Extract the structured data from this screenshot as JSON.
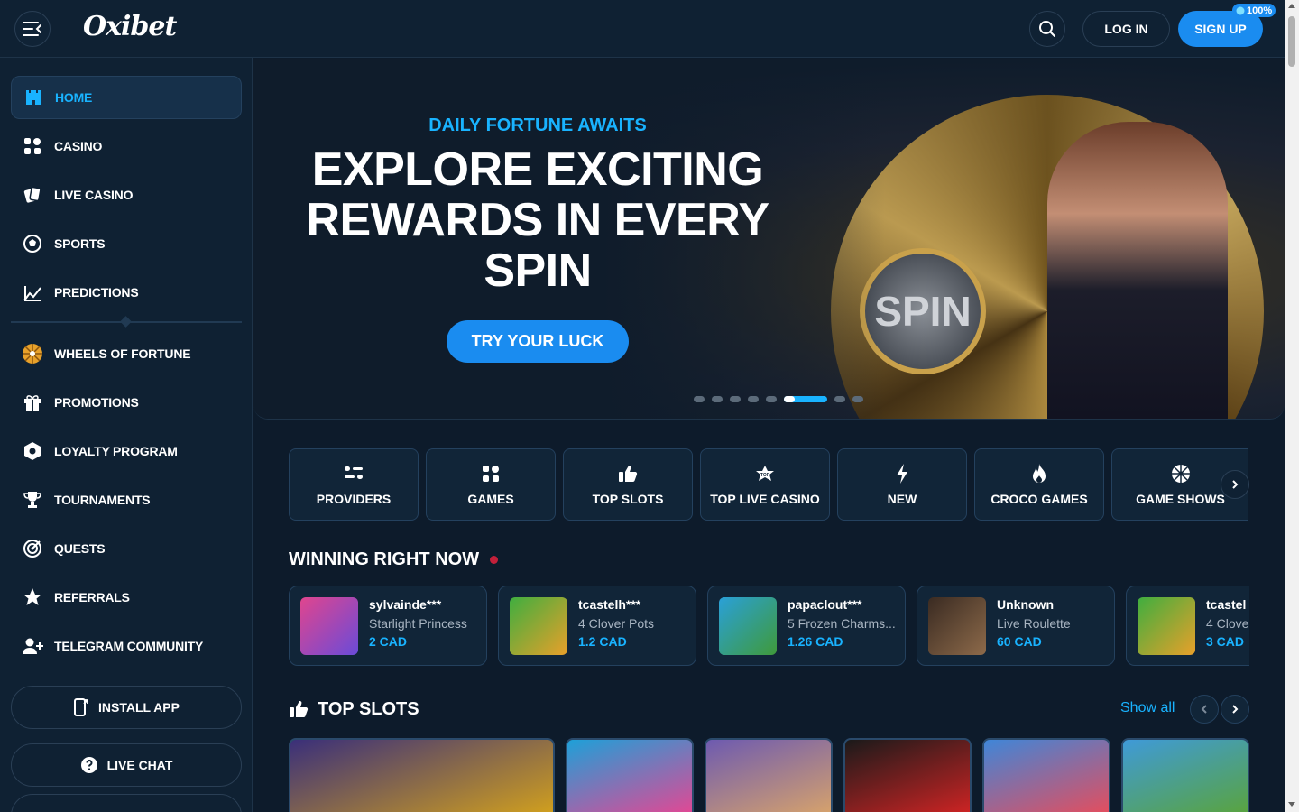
{
  "header": {
    "logo": "Oxibet",
    "login_label": "LOG IN",
    "signup_label": "SIGN UP",
    "signup_badge": "100%"
  },
  "sidebar": {
    "items": [
      {
        "label": "HOME",
        "icon": "castle-icon",
        "active": true
      },
      {
        "label": "CASINO",
        "icon": "grid-icon"
      },
      {
        "label": "LIVE CASINO",
        "icon": "cards-icon"
      },
      {
        "label": "SPORTS",
        "icon": "soccer-ball-icon"
      },
      {
        "label": "PREDICTIONS",
        "icon": "chart-icon"
      },
      {
        "label": "WHEELS OF FORTUNE",
        "icon": "wheel-icon"
      },
      {
        "label": "PROMOTIONS",
        "icon": "gift-icon"
      },
      {
        "label": "LOYALTY PROGRAM",
        "icon": "hexagon-icon"
      },
      {
        "label": "TOURNAMENTS",
        "icon": "trophy-icon"
      },
      {
        "label": "QUESTS",
        "icon": "target-icon"
      },
      {
        "label": "REFERRALS",
        "icon": "star-icon"
      },
      {
        "label": "TELEGRAM COMMUNITY",
        "icon": "add-user-icon"
      }
    ],
    "install_label": "INSTALL APP",
    "chat_label": "LIVE CHAT"
  },
  "hero": {
    "eyebrow": "DAILY FORTUNE AWAITS",
    "title": "EXPLORE EXCITING REWARDS IN EVERY SPIN",
    "cta": "TRY YOUR LUCK",
    "wheel_text": "SPIN",
    "slide_count": 8,
    "active_slide": 6
  },
  "categories": [
    {
      "label": "PROVIDERS",
      "icon": "providers-icon"
    },
    {
      "label": "GAMES",
      "icon": "grid-icon"
    },
    {
      "label": "TOP SLOTS",
      "icon": "thumbs-up-icon"
    },
    {
      "label": "TOP LIVE CASINO",
      "icon": "top-badge-icon"
    },
    {
      "label": "NEW",
      "icon": "lightning-icon"
    },
    {
      "label": "CROCO GAMES",
      "icon": "flame-icon"
    },
    {
      "label": "GAME SHOWS",
      "icon": "wheel-icon"
    }
  ],
  "winning": {
    "title": "WINNING RIGHT NOW",
    "items": [
      {
        "user": "sylvainde***",
        "game": "Starlight Princess",
        "amount": "2 CAD",
        "thumb": [
          "#e0458e",
          "#6a4bd8"
        ]
      },
      {
        "user": "tcastelh***",
        "game": "4 Clover Pots",
        "amount": "1.2 CAD",
        "thumb": [
          "#3fae3f",
          "#e8a02a"
        ]
      },
      {
        "user": "papaclout***",
        "game": "5 Frozen Charms...",
        "amount": "1.26 CAD",
        "thumb": [
          "#2aa0d8",
          "#3f9a3a"
        ]
      },
      {
        "user": "Unknown",
        "game": "Live Roulette",
        "amount": "60 CAD",
        "thumb": [
          "#3a2b22",
          "#8d6a4a"
        ]
      },
      {
        "user": "tcastel",
        "game": "4 Clove",
        "amount": "3 CAD",
        "thumb": [
          "#3fae3f",
          "#e8a02a"
        ]
      }
    ]
  },
  "top_slots": {
    "title": "TOP SLOTS",
    "show_all": "Show all",
    "thumbs": [
      [
        "#3a2f7a",
        "#d4a21c"
      ],
      [
        "#1ea0d8",
        "#e84592"
      ],
      [
        "#6d5ab0",
        "#d9a46a"
      ],
      [
        "#1a1a1a",
        "#d32424"
      ],
      [
        "#3f86d8",
        "#e94c5a"
      ],
      [
        "#3f9ad8",
        "#5aa43a"
      ]
    ]
  }
}
